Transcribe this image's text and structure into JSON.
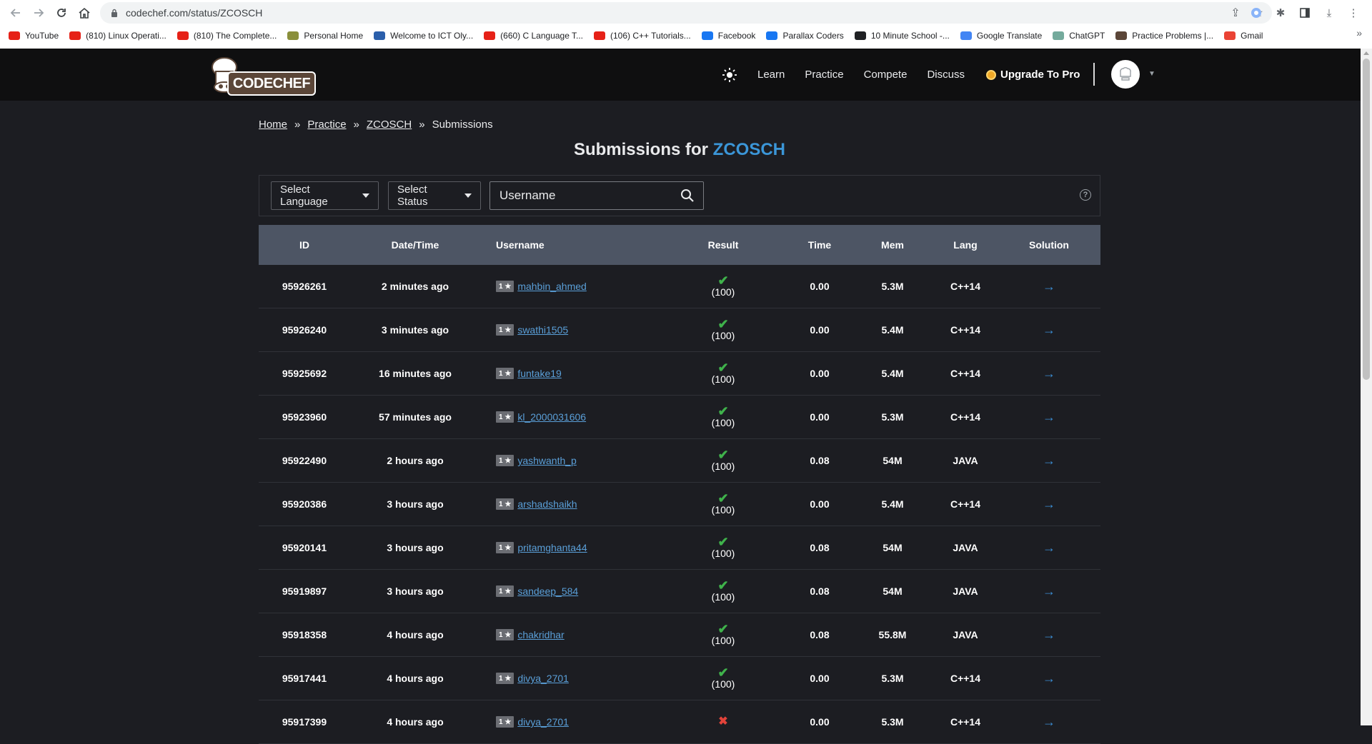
{
  "browser": {
    "url": "codechef.com/status/ZCOSCH",
    "bookmarks": [
      {
        "label": "YouTube",
        "icon": "youtube-icon",
        "color": "#e62117"
      },
      {
        "label": "(810) Linux Operati...",
        "icon": "youtube-icon",
        "color": "#e62117"
      },
      {
        "label": "(810) The Complete...",
        "icon": "youtube-icon",
        "color": "#e62117"
      },
      {
        "label": "Personal Home",
        "icon": "home-icon",
        "color": "#8a8f3b"
      },
      {
        "label": "Welcome to ICT Oly...",
        "icon": "olympiad-icon",
        "color": "#2b5fab"
      },
      {
        "label": "(660) C Language T...",
        "icon": "youtube-icon",
        "color": "#e62117"
      },
      {
        "label": "(106) C++ Tutorials...",
        "icon": "youtube-icon",
        "color": "#e62117"
      },
      {
        "label": "Facebook",
        "icon": "facebook-icon",
        "color": "#1877f2"
      },
      {
        "label": "Parallax Coders",
        "icon": "facebook-icon",
        "color": "#1877f2"
      },
      {
        "label": "10 Minute School -...",
        "icon": "ten-minute-school-icon",
        "color": "#202124"
      },
      {
        "label": "Google Translate",
        "icon": "translate-icon",
        "color": "#4285f4"
      },
      {
        "label": "ChatGPT",
        "icon": "chatgpt-icon",
        "color": "#74aa9c"
      },
      {
        "label": "Practice Problems |...",
        "icon": "codechef-icon",
        "color": "#5b4638"
      },
      {
        "label": "Gmail",
        "icon": "gmail-icon",
        "color": "#ea4335"
      }
    ],
    "more": "»"
  },
  "header": {
    "logo_text": "CODECHEF",
    "nav": [
      "Learn",
      "Practice",
      "Compete",
      "Discuss"
    ],
    "upgrade": "Upgrade To Pro"
  },
  "breadcrumb": {
    "home": "Home",
    "practice": "Practice",
    "problem": "ZCOSCH",
    "current": "Submissions",
    "sep": "»"
  },
  "title": {
    "prefix": "Submissions for",
    "code": "ZCOSCH"
  },
  "filters": {
    "language": "Select Language",
    "status": "Select Status",
    "username_placeholder": "Username",
    "help": "?"
  },
  "table": {
    "headers": {
      "id": "ID",
      "datetime": "Date/Time",
      "username": "Username",
      "result": "Result",
      "time": "Time",
      "mem": "Mem",
      "lang": "Lang",
      "solution": "Solution"
    },
    "rows": [
      {
        "id": "95926261",
        "datetime": "2 minutes ago",
        "stars": "1 ★",
        "user": "mahbin_ahmed",
        "score": "(100)",
        "ok": true,
        "time": "0.00",
        "mem": "5.3M",
        "lang": "C++14"
      },
      {
        "id": "95926240",
        "datetime": "3 minutes ago",
        "stars": "1 ★",
        "user": "swathi1505",
        "score": "(100)",
        "ok": true,
        "time": "0.00",
        "mem": "5.4M",
        "lang": "C++14"
      },
      {
        "id": "95925692",
        "datetime": "16 minutes ago",
        "stars": "1 ★",
        "user": "funtake19",
        "score": "(100)",
        "ok": true,
        "time": "0.00",
        "mem": "5.4M",
        "lang": "C++14"
      },
      {
        "id": "95923960",
        "datetime": "57 minutes ago",
        "stars": "1 ★",
        "user": "kl_2000031606",
        "score": "(100)",
        "ok": true,
        "time": "0.00",
        "mem": "5.3M",
        "lang": "C++14"
      },
      {
        "id": "95922490",
        "datetime": "2 hours ago",
        "stars": "1 ★",
        "user": "yashwanth_p",
        "score": "(100)",
        "ok": true,
        "time": "0.08",
        "mem": "54M",
        "lang": "JAVA"
      },
      {
        "id": "95920386",
        "datetime": "3 hours ago",
        "stars": "1 ★",
        "user": "arshadshaikh",
        "score": "(100)",
        "ok": true,
        "time": "0.00",
        "mem": "5.4M",
        "lang": "C++14"
      },
      {
        "id": "95920141",
        "datetime": "3 hours ago",
        "stars": "1 ★",
        "user": "pritamghanta44",
        "score": "(100)",
        "ok": true,
        "time": "0.08",
        "mem": "54M",
        "lang": "JAVA"
      },
      {
        "id": "95919897",
        "datetime": "3 hours ago",
        "stars": "1 ★",
        "user": "sandeep_584",
        "score": "(100)",
        "ok": true,
        "time": "0.08",
        "mem": "54M",
        "lang": "JAVA"
      },
      {
        "id": "95918358",
        "datetime": "4 hours ago",
        "stars": "1 ★",
        "user": "chakridhar",
        "score": "(100)",
        "ok": true,
        "time": "0.08",
        "mem": "55.8M",
        "lang": "JAVA"
      },
      {
        "id": "95917441",
        "datetime": "4 hours ago",
        "stars": "1 ★",
        "user": "divya_2701",
        "score": "(100)",
        "ok": true,
        "time": "0.00",
        "mem": "5.3M",
        "lang": "C++14"
      },
      {
        "id": "95917399",
        "datetime": "4 hours ago",
        "stars": "1 ★",
        "user": "divya_2701",
        "score": "",
        "ok": false,
        "time": "0.00",
        "mem": "5.3M",
        "lang": "C++14"
      }
    ],
    "check_glyph": "✔",
    "cross_glyph": "✖",
    "arrow_glyph": "→"
  }
}
